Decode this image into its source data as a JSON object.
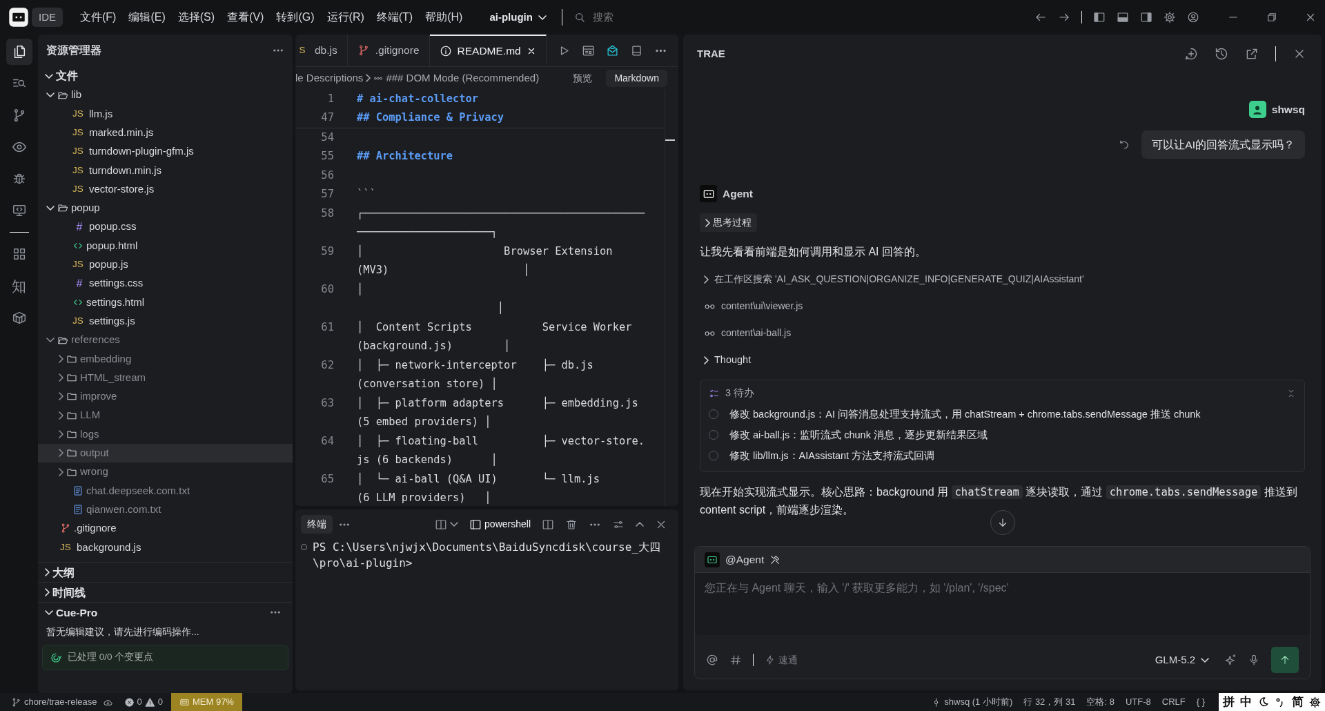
{
  "title_bar": {
    "badge": "IDE",
    "menus": [
      "文件(F)",
      "编辑(E)",
      "选择(S)",
      "查看(V)",
      "转到(G)",
      "运行(R)",
      "终端(T)",
      "帮助(H)"
    ],
    "project": "ai-plugin",
    "search": {
      "placeholder": "搜索"
    }
  },
  "activity_bar": [
    {
      "kind": "files",
      "selected": true
    },
    {
      "kind": "search",
      "selected": false
    },
    {
      "kind": "branch",
      "selected": false
    },
    {
      "kind": "eye",
      "selected": false
    },
    {
      "kind": "bug",
      "selected": false
    },
    {
      "kind": "monitor",
      "selected": false
    },
    {
      "kind": "grid",
      "selected": false
    },
    {
      "kind": "glyph",
      "label": "知",
      "selected": false
    },
    {
      "kind": "cube",
      "selected": false
    }
  ],
  "explorer": {
    "title": "资源管理器",
    "section": "文件",
    "tree": [
      {
        "label": "lib",
        "kind": "folder",
        "expanded": true,
        "ignored": false,
        "selected": false,
        "children": [
          {
            "label": "llm.js",
            "kind": "js",
            "icon_text": "JS",
            "ignored": false,
            "selected": false
          },
          {
            "label": "marked.min.js",
            "kind": "js",
            "icon_text": "JS",
            "ignored": false,
            "selected": false
          },
          {
            "label": "turndown-plugin-gfm.js",
            "kind": "js",
            "icon_text": "JS",
            "ignored": false,
            "selected": false
          },
          {
            "label": "turndown.min.js",
            "kind": "js",
            "icon_text": "JS",
            "ignored": false,
            "selected": false
          },
          {
            "label": "vector-store.js",
            "kind": "js",
            "icon_text": "JS",
            "ignored": false,
            "selected": false
          }
        ]
      },
      {
        "label": "popup",
        "kind": "folder",
        "expanded": true,
        "ignored": false,
        "selected": false,
        "children": [
          {
            "label": "popup.css",
            "kind": "css",
            "icon_text": "#",
            "ignored": false,
            "selected": false
          },
          {
            "label": "popup.html",
            "kind": "html",
            "ignored": false,
            "selected": false
          },
          {
            "label": "popup.js",
            "kind": "js",
            "icon_text": "JS",
            "ignored": false,
            "selected": false
          },
          {
            "label": "settings.css",
            "kind": "css",
            "icon_text": "#",
            "ignored": false,
            "selected": false
          },
          {
            "label": "settings.html",
            "kind": "html",
            "ignored": false,
            "selected": false
          },
          {
            "label": "settings.js",
            "kind": "js",
            "icon_text": "JS",
            "ignored": false,
            "selected": false
          }
        ]
      },
      {
        "label": "references",
        "kind": "folder",
        "expanded": true,
        "ignored": true,
        "selected": false,
        "children": [
          {
            "label": "embedding",
            "kind": "folder",
            "expanded": false,
            "ignored": true,
            "selected": false
          },
          {
            "label": "HTML_stream",
            "kind": "folder",
            "expanded": false,
            "ignored": true,
            "selected": false
          },
          {
            "label": "improve",
            "kind": "folder",
            "expanded": false,
            "ignored": true,
            "selected": false
          },
          {
            "label": "LLM",
            "kind": "folder",
            "expanded": false,
            "ignored": true,
            "selected": false
          },
          {
            "label": "logs",
            "kind": "folder",
            "expanded": false,
            "ignored": true,
            "selected": false
          },
          {
            "label": "output",
            "kind": "folder",
            "expanded": false,
            "ignored": true,
            "selected": true
          },
          {
            "label": "wrong",
            "kind": "folder",
            "expanded": false,
            "ignored": true,
            "selected": false
          },
          {
            "label": "chat.deepseek.com.txt",
            "kind": "txt",
            "ignored": true,
            "selected": false
          },
          {
            "label": "qianwen.com.txt",
            "kind": "txt",
            "ignored": true,
            "selected": false
          }
        ]
      },
      {
        "label": ".gitignore",
        "kind": "git",
        "ignored": false,
        "selected": false
      },
      {
        "label": "background.js",
        "kind": "js",
        "icon_text": "JS",
        "ignored": false,
        "selected": false
      }
    ]
  },
  "panels": [
    {
      "title": "大纲",
      "expanded": false
    },
    {
      "title": "时间线",
      "expanded": false
    },
    {
      "title": "Cue-Pro",
      "expanded": true,
      "message": "暂无编辑建议，请先进行编码操作...",
      "status": "已处理 0/0 个变更点"
    }
  ],
  "editor": {
    "tabs": [
      {
        "label": "db.js",
        "kind": "js",
        "icon_text": "S",
        "selected": false
      },
      {
        "label": ".gitignore",
        "kind": "git",
        "selected": false
      },
      {
        "label": "README.md",
        "kind": "info",
        "selected": true
      }
    ],
    "breadcrumb": [
      "le Descriptions",
      "### DOM Mode (Recommended)"
    ],
    "preview": "预览",
    "language_mode": "Markdown",
    "sticky_lines": [
      {
        "number": "1",
        "kind": "heading",
        "rows": [
          "# ai-chat-collector"
        ]
      },
      {
        "number": "47",
        "kind": "heading",
        "rows": [
          "## Compliance & Privacy"
        ]
      }
    ],
    "lines": [
      {
        "number": "54"
      },
      {
        "number": "55",
        "kind": "heading",
        "rows": [
          "## Architecture"
        ]
      },
      {
        "number": "56"
      },
      {
        "number": "57",
        "kind": "fence",
        "rows": [
          "```"
        ]
      },
      {
        "number": "58",
        "kind": "text",
        "rows": [
          "┌────────────────────────────────────────────",
          "─────────────────────┐"
        ]
      },
      {
        "number": "59",
        "kind": "text",
        "rows": [
          "│                      Browser Extension",
          "(MV3)                     │"
        ]
      },
      {
        "number": "60",
        "kind": "text",
        "rows": [
          "│",
          "                      │"
        ]
      },
      {
        "number": "61",
        "kind": "text",
        "rows": [
          "│  Content Scripts           Service Worker",
          "(background.js)        │"
        ]
      },
      {
        "number": "62",
        "kind": "text",
        "rows": [
          "│  ├─ network-interceptor    ├─ db.js",
          "(conversation store) │"
        ]
      },
      {
        "number": "63",
        "kind": "text",
        "rows": [
          "│  ├─ platform adapters      ├─ embedding.js",
          "(5 embed providers) │"
        ]
      },
      {
        "number": "64",
        "kind": "text",
        "rows": [
          "│  ├─ floating-ball          ├─ vector-store.",
          "js (6 backends)      │"
        ]
      },
      {
        "number": "65",
        "kind": "text",
        "rows": [
          "│  └─ ai-ball (Q&A UI)       └─ llm.js",
          "(6 LLM providers)   │"
        ]
      }
    ]
  },
  "terminal": {
    "tabs": [
      {
        "label": "终端",
        "selected": true
      }
    ],
    "shell": "powershell",
    "output": "PS C:\\Users\\njwjx\\Documents\\BaiduSyncdisk\\course_大四\\pro\\ai-plugin>"
  },
  "chat": {
    "title": "TRAE",
    "user": {
      "name": "shwsq",
      "message": "可以让AI的回答流式显示吗？"
    },
    "agent": {
      "name": "Agent",
      "steps": [
        {
          "kind": "chip",
          "label": "思考过程",
          "expanded": false
        },
        {
          "kind": "paragraph",
          "segments": [
            {
              "kind": "text",
              "text": "让我先看看前端是如何调用和显示 AI 回答的。"
            }
          ]
        },
        {
          "kind": "search",
          "label": "在工作区搜索 'AI_ASK_QUESTION|ORGANIZE_INFO|GENERATE_QUIZ|AIAssistant'",
          "expanded": false
        },
        {
          "kind": "read",
          "label": "content\\ui\\viewer.js"
        },
        {
          "kind": "read",
          "label": "content\\ai-ball.js"
        },
        {
          "kind": "toggle",
          "label": "Thought",
          "expanded": false
        },
        {
          "kind": "todo",
          "title": "3 待办",
          "items": [
            {
              "text": "修改 background.js：AI 问答消息处理支持流式，用 chatStream + chrome.tabs.sendMessage 推送 chunk",
              "done": false
            },
            {
              "text": "修改 ai-ball.js：监听流式 chunk 消息，逐步更新结果区域",
              "done": false
            },
            {
              "text": "修改 lib/llm.js：AIAssistant 方法支持流式回调",
              "done": false
            }
          ]
        },
        {
          "kind": "paragraph",
          "segments": [
            {
              "kind": "text",
              "text": "现在开始实现流式显示。核心思路：background 用 "
            },
            {
              "kind": "code",
              "text": "chatStream"
            },
            {
              "kind": "text",
              "text": " 逐块读取，通过 "
            },
            {
              "kind": "code",
              "text": "chrome.tabs.sendMessage"
            },
            {
              "kind": "text",
              "text": " 推送到 content script，前端逐步渲染。"
            }
          ]
        }
      ]
    },
    "composer": {
      "mention": "@Agent",
      "placeholder": "您正在与 Agent 聊天，输入 '/' 获取更多能力，如 '/plan', '/spec'",
      "mode": "速通",
      "model": "GLM-5.2"
    }
  },
  "status_bar": {
    "branch": "chore/trae-release",
    "errors": "0",
    "warnings": "0",
    "memory": "MEM 97%",
    "author": "shwsq (1 小时前)",
    "position": "行 32，列 31",
    "indent": "空格: 8",
    "encoding": "UTF-8",
    "eol": "CRLF",
    "language": "{ }",
    "ime": [
      {
        "kind": "glyph",
        "label": "拼"
      },
      {
        "kind": "glyph",
        "label": "中"
      },
      {
        "kind": "moon"
      },
      {
        "kind": "punct"
      },
      {
        "kind": "glyph",
        "label": "简"
      },
      {
        "kind": "gear"
      }
    ]
  }
}
